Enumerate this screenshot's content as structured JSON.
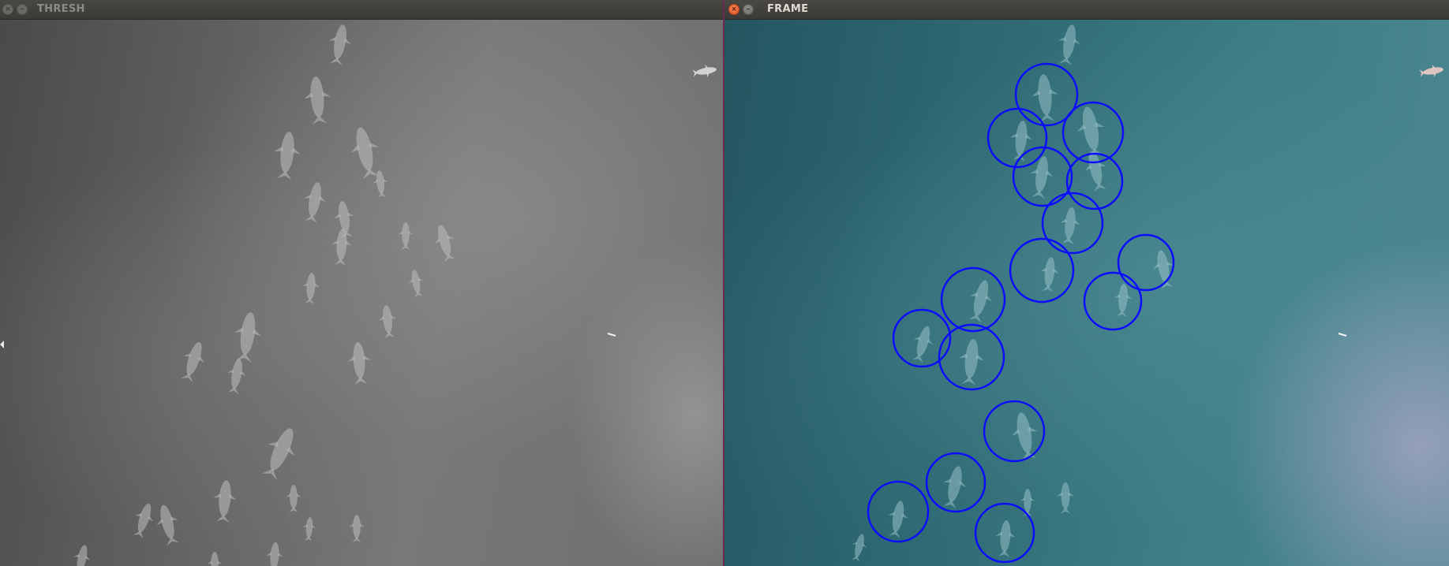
{
  "windows": [
    {
      "title": "THRESH",
      "focused": false,
      "buttons": {
        "close_icon": "close-icon",
        "minimize_icon": "minimize-icon"
      },
      "scene": "grayscale threshold view of dolphin pod from above"
    },
    {
      "title": "FRAME",
      "focused": true,
      "buttons": {
        "close_icon": "close-icon",
        "minimize_icon": "minimize-icon"
      },
      "detection_circle_color": "#0c0cff",
      "detection_count": 17
    }
  ],
  "colors": {
    "titlebar": "#3b3a36",
    "close_active": "#e0501f",
    "detection": "#0c0cff"
  }
}
